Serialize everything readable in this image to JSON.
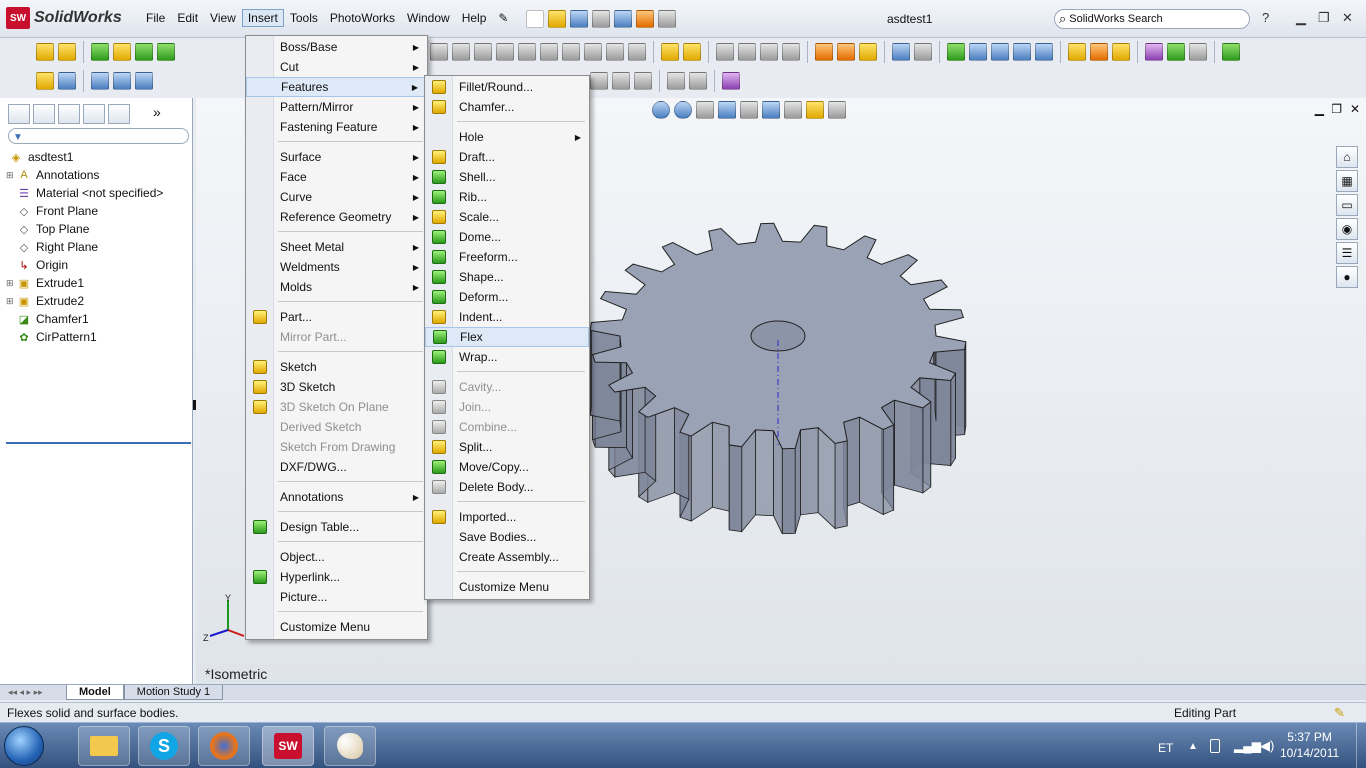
{
  "app": {
    "logo_badge": "SW",
    "logo_name": "SolidWorks",
    "document_title": "asdtest1",
    "search_placeholder": "SolidWorks Search"
  },
  "menubar": [
    "File",
    "Edit",
    "View",
    "Insert",
    "Tools",
    "PhotoWorks",
    "Window",
    "Help"
  ],
  "insert_menu": [
    {
      "label": "Boss/Base",
      "submenu": true
    },
    {
      "label": "Cut",
      "submenu": true
    },
    {
      "label": "Features",
      "submenu": true,
      "highlighted": true
    },
    {
      "label": "Pattern/Mirror",
      "submenu": true
    },
    {
      "label": "Fastening Feature",
      "submenu": true
    },
    {
      "sep": true
    },
    {
      "label": "Surface",
      "submenu": true
    },
    {
      "label": "Face",
      "submenu": true
    },
    {
      "label": "Curve",
      "submenu": true
    },
    {
      "label": "Reference Geometry",
      "submenu": true
    },
    {
      "sep": true
    },
    {
      "label": "Sheet Metal",
      "submenu": true
    },
    {
      "label": "Weldments",
      "submenu": true
    },
    {
      "label": "Molds",
      "submenu": true
    },
    {
      "sep": true
    },
    {
      "label": "Part...",
      "icon": "part-icon"
    },
    {
      "label": "Mirror Part...",
      "disabled": true
    },
    {
      "sep": true
    },
    {
      "label": "Sketch",
      "icon": "sketch-icon"
    },
    {
      "label": "3D Sketch",
      "icon": "3d-sketch-icon"
    },
    {
      "label": "3D Sketch On Plane",
      "disabled": true,
      "icon": "3d-sketch-plane-icon"
    },
    {
      "label": "Derived Sketch",
      "disabled": true
    },
    {
      "label": "Sketch From Drawing",
      "disabled": true
    },
    {
      "label": "DXF/DWG..."
    },
    {
      "sep": true
    },
    {
      "label": "Annotations",
      "submenu": true
    },
    {
      "sep": true
    },
    {
      "label": "Design Table...",
      "icon": "design-table-icon"
    },
    {
      "sep": true
    },
    {
      "label": "Object..."
    },
    {
      "label": "Hyperlink...",
      "icon": "hyperlink-icon"
    },
    {
      "label": "Picture..."
    },
    {
      "sep": true
    },
    {
      "label": "Customize Menu"
    }
  ],
  "features_menu": [
    {
      "label": "Fillet/Round...",
      "icon": "fillet-icon"
    },
    {
      "label": "Chamfer...",
      "icon": "chamfer-icon"
    },
    {
      "sep": true
    },
    {
      "label": "Hole",
      "submenu": true
    },
    {
      "label": "Draft...",
      "icon": "draft-icon"
    },
    {
      "label": "Shell...",
      "icon": "shell-icon"
    },
    {
      "label": "Rib...",
      "icon": "rib-icon"
    },
    {
      "label": "Scale...",
      "icon": "scale-icon"
    },
    {
      "label": "Dome...",
      "icon": "dome-icon"
    },
    {
      "label": "Freeform...",
      "icon": "freeform-icon"
    },
    {
      "label": "Shape...",
      "icon": "shape-icon"
    },
    {
      "label": "Deform...",
      "icon": "deform-icon"
    },
    {
      "label": "Indent...",
      "icon": "indent-icon"
    },
    {
      "label": "Flex",
      "icon": "flex-icon",
      "highlighted": true
    },
    {
      "label": "Wrap...",
      "icon": "wrap-icon"
    },
    {
      "sep": true
    },
    {
      "label": "Cavity...",
      "disabled": true,
      "icon": "cavity-icon"
    },
    {
      "label": "Join...",
      "disabled": true,
      "icon": "join-icon"
    },
    {
      "label": "Combine...",
      "disabled": true,
      "icon": "combine-icon"
    },
    {
      "label": "Split...",
      "icon": "split-icon"
    },
    {
      "label": "Move/Copy...",
      "icon": "move-copy-icon"
    },
    {
      "label": "Delete Body...",
      "icon": "delete-body-icon"
    },
    {
      "sep": true
    },
    {
      "label": "Imported...",
      "icon": "imported-icon"
    },
    {
      "label": "Save Bodies..."
    },
    {
      "label": "Create Assembly..."
    },
    {
      "sep": true
    },
    {
      "label": "Customize Menu"
    }
  ],
  "feature_tree": [
    {
      "label": "asdtest1",
      "icon": "part-icon",
      "expander": false,
      "indent": 0
    },
    {
      "label": "Annotations",
      "icon": "annotations-icon",
      "expander": true,
      "indent": 1
    },
    {
      "label": "Material <not specified>",
      "icon": "material-icon",
      "expander": false,
      "indent": 1
    },
    {
      "label": "Front Plane",
      "icon": "plane-icon",
      "expander": false,
      "indent": 1
    },
    {
      "label": "Top Plane",
      "icon": "plane-icon",
      "expander": false,
      "indent": 1
    },
    {
      "label": "Right Plane",
      "icon": "plane-icon",
      "expander": false,
      "indent": 1
    },
    {
      "label": "Origin",
      "icon": "origin-icon",
      "expander": false,
      "indent": 1
    },
    {
      "label": "Extrude1",
      "icon": "extrude-icon",
      "expander": true,
      "indent": 1
    },
    {
      "label": "Extrude2",
      "icon": "extrude-icon",
      "expander": true,
      "indent": 1
    },
    {
      "label": "Chamfer1",
      "icon": "chamfer-icon",
      "expander": false,
      "indent": 1
    },
    {
      "label": "CirPattern1",
      "icon": "circular-pattern-icon",
      "expander": false,
      "indent": 1
    }
  ],
  "viewport": {
    "view_label": "*Isometric"
  },
  "bottom_tabs": [
    "Model",
    "Motion Study 1"
  ],
  "status": {
    "message": "Flexes solid and surface bodies.",
    "mode": "Editing Part"
  },
  "taskbar": {
    "language": "ET",
    "time": "5:37 PM",
    "date": "10/14/2011",
    "solidworks_badge": "SW"
  },
  "colors": {
    "menu_highlight": "#dde9f7",
    "gear_top": "#9aa2b6",
    "gear_side": "#7f879b",
    "tree_bar": "#3a6fb5"
  }
}
